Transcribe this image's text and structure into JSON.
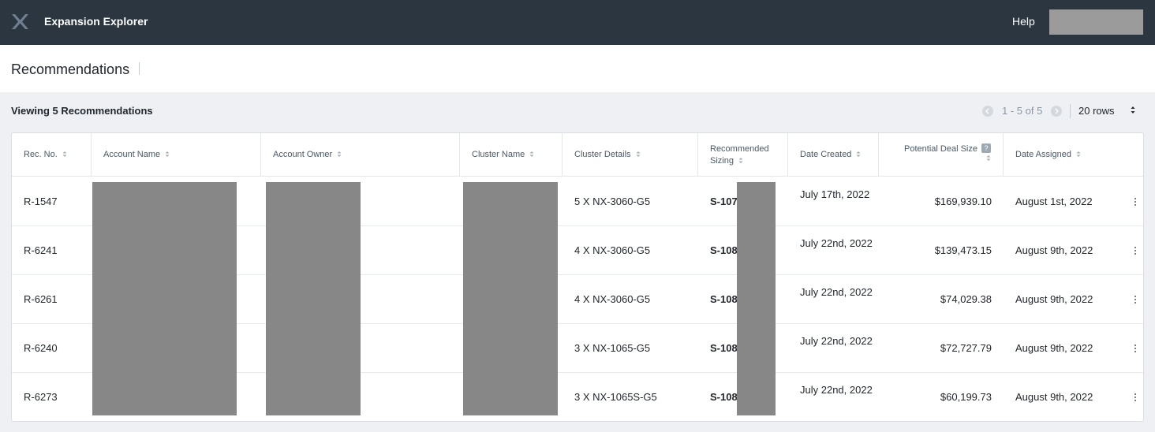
{
  "app": {
    "title": "Expansion Explorer",
    "logo_icon": "x-logo-icon",
    "help_label": "Help"
  },
  "page": {
    "title": "Recommendations"
  },
  "toolbar": {
    "viewing_label": "Viewing 5 Recommendations",
    "pagination": "1 - 5 of 5",
    "rows_per_page": "20 rows"
  },
  "table": {
    "columns": [
      {
        "label": "Rec. No."
      },
      {
        "label": "Account Name"
      },
      {
        "label": "Account Owner"
      },
      {
        "label": "Cluster Name"
      },
      {
        "label": "Cluster Details"
      },
      {
        "label": "Recommended Sizing"
      },
      {
        "label": "Date Created"
      },
      {
        "label": "Potential Deal Size"
      },
      {
        "label": "Date Assigned"
      }
    ],
    "rows": [
      {
        "rec_no": "R-1547",
        "cluster_details": "5 X NX-3060-G5",
        "sizing": "S-107",
        "date_created": "July 17th, 2022",
        "deal_size": "$169,939.10",
        "date_assigned": "August 1st, 2022"
      },
      {
        "rec_no": "R-6241",
        "cluster_details": "4 X NX-3060-G5",
        "sizing": "S-108",
        "date_created": "July 22nd, 2022",
        "deal_size": "$139,473.15",
        "date_assigned": "August 9th, 2022"
      },
      {
        "rec_no": "R-6261",
        "cluster_details": "4 X NX-3060-G5",
        "sizing": "S-108",
        "date_created": "July 22nd, 2022",
        "deal_size": "$74,029.38",
        "date_assigned": "August 9th, 2022"
      },
      {
        "rec_no": "R-6240",
        "cluster_details": "3 X NX-1065-G5",
        "sizing": "S-108",
        "date_created": "July 22nd, 2022",
        "deal_size": "$72,727.79",
        "date_assigned": "August 9th, 2022"
      },
      {
        "rec_no": "R-6273",
        "cluster_details": "3 X NX-1065S-G5",
        "sizing": "S-108",
        "date_created": "July 22nd, 2022",
        "deal_size": "$60,199.73",
        "date_assigned": "August 9th, 2022"
      }
    ]
  },
  "colors": {
    "topbar": "#2b3641",
    "redaction": "#878787",
    "page_bg": "#eef0f3"
  }
}
